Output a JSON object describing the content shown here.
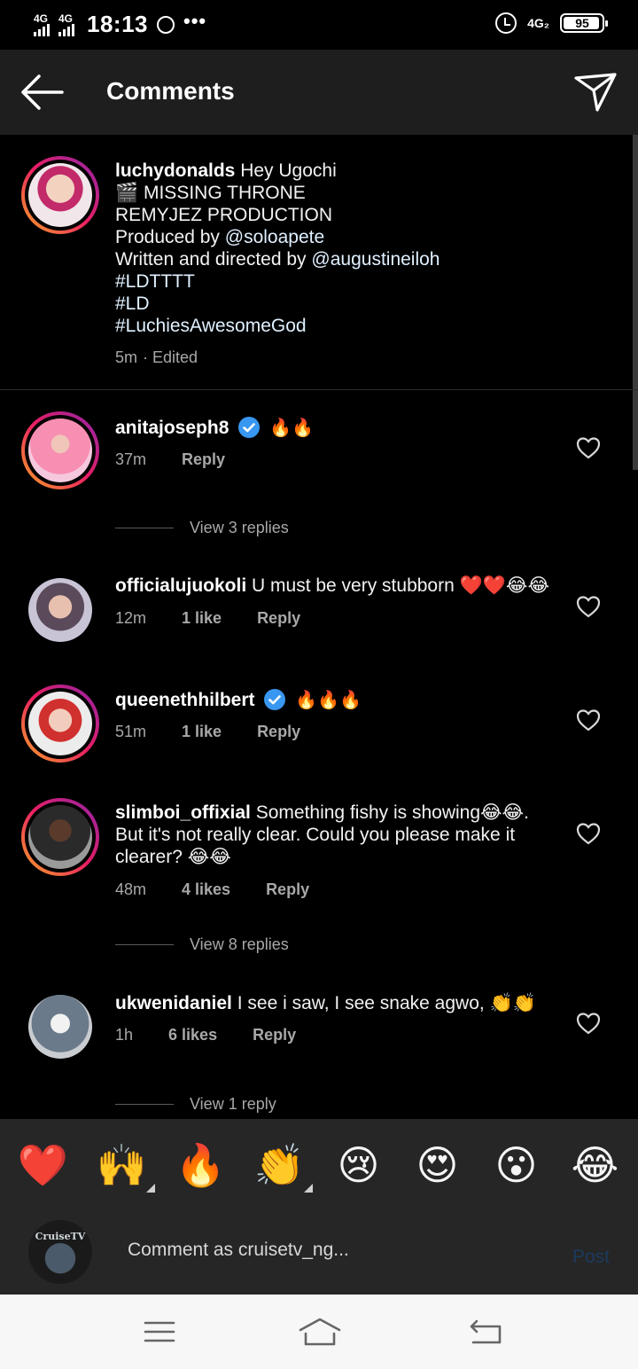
{
  "status_bar": {
    "network1": "4G",
    "network2": "4G",
    "time": "18:13",
    "more": "•••",
    "net_right": "4G₂",
    "battery": "95",
    "battery_level": 0.95
  },
  "header": {
    "title": "Comments"
  },
  "caption": {
    "username": "luchydonalds",
    "lines": [
      "Hey Ugochi",
      "🎬 MISSING THRONE",
      "REMYJEZ PRODUCTION",
      "Produced by ",
      "@soloapete",
      "Written and directed by ",
      "@augustineiloh",
      "#LDTTTT",
      "#LD",
      "#LuchiesAwesomeGod"
    ],
    "time": "5m",
    "edited": "· Edited"
  },
  "comments": [
    {
      "username": "anitajoseph8",
      "verified": true,
      "text": "🔥🔥",
      "time": "37m",
      "likes": "",
      "reply": "Reply",
      "view_replies": "View 3 replies"
    },
    {
      "username": "officialujuokoli",
      "verified": false,
      "text": "U must be very stubborn ❤️❤️😂😂",
      "time": "12m",
      "likes": "1 like",
      "reply": "Reply"
    },
    {
      "username": "queenethhilbert",
      "verified": true,
      "text": "🔥🔥🔥",
      "time": "51m",
      "likes": "1 like",
      "reply": "Reply"
    },
    {
      "username": "slimboi_offixial",
      "verified": false,
      "text_line1": "Something fishy is showing😂😂.",
      "text_line2": "But it's not really clear. Could you please make it",
      "text_line3": "clearer? 😂😂",
      "time": "48m",
      "likes": "4 likes",
      "reply": "Reply",
      "view_replies": "View 8 replies"
    },
    {
      "username": "ukwenidaniel",
      "verified": false,
      "text": "I see i saw, I see snake agwo, 👏👏",
      "time": "1h",
      "likes": "6 likes",
      "reply": "Reply",
      "view_replies": "View 1 reply"
    }
  ],
  "emoji_bar": [
    "❤️",
    "🙌",
    "🔥",
    "👏",
    "😢",
    "😍",
    "😮",
    "😂"
  ],
  "composer": {
    "avatar_text": "CruiseTV",
    "placeholder": "Comment as cruisetv_ng...",
    "post_label": "Post"
  },
  "icons": {
    "back": "arrow-left-icon",
    "send": "paper-plane-icon",
    "like": "heart-outline-icon",
    "verified": "verified-badge-icon",
    "nav_menu": "menu-icon",
    "nav_home": "home-icon",
    "nav_back": "back-icon"
  },
  "colors": {
    "background": "#000000",
    "app_bar": "#1e1e1e",
    "composer": "#262626",
    "verified": "#3897f0",
    "muted_text": "#a8a8a8",
    "post_disabled": "#1c3a5e",
    "story_ring_start": "#f9a825",
    "story_ring_end": "#8e24aa"
  }
}
